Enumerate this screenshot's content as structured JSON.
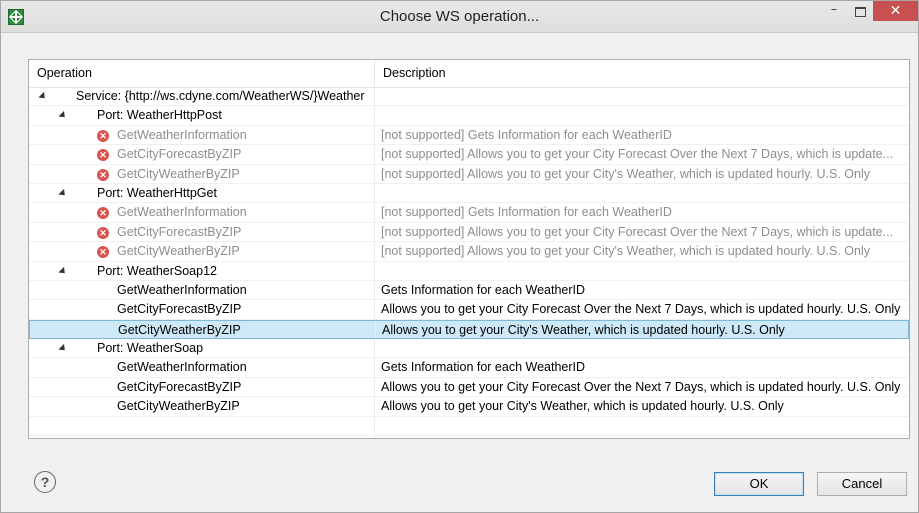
{
  "window": {
    "title": "Choose WS operation...",
    "controls": {
      "minimize": "–",
      "close": "✕"
    }
  },
  "table": {
    "columns": [
      "Operation",
      "Description"
    ],
    "rows": [
      {
        "level": 0,
        "op": "Service: {http://ws.cdyne.com/WeatherWS/}Weather",
        "desc": "",
        "error": false,
        "disabled": false
      },
      {
        "level": 1,
        "op": "Port: WeatherHttpPost",
        "desc": "",
        "error": false,
        "disabled": false
      },
      {
        "level": 2,
        "op": "GetWeatherInformation",
        "desc": "[not supported] Gets Information for each WeatherID",
        "error": true,
        "disabled": true
      },
      {
        "level": 2,
        "op": "GetCityForecastByZIP",
        "desc": "[not supported] Allows you to get your City Forecast Over the Next 7 Days, which is update...",
        "error": true,
        "disabled": true
      },
      {
        "level": 2,
        "op": "GetCityWeatherByZIP",
        "desc": "[not supported] Allows you to get your City's Weather, which is updated hourly. U.S. Only",
        "error": true,
        "disabled": true
      },
      {
        "level": 1,
        "op": "Port: WeatherHttpGet",
        "desc": "",
        "error": false,
        "disabled": false
      },
      {
        "level": 2,
        "op": "GetWeatherInformation",
        "desc": "[not supported] Gets Information for each WeatherID",
        "error": true,
        "disabled": true
      },
      {
        "level": 2,
        "op": "GetCityForecastByZIP",
        "desc": "[not supported] Allows you to get your City Forecast Over the Next 7 Days, which is update...",
        "error": true,
        "disabled": true
      },
      {
        "level": 2,
        "op": "GetCityWeatherByZIP",
        "desc": "[not supported] Allows you to get your City's Weather, which is updated hourly. U.S. Only",
        "error": true,
        "disabled": true
      },
      {
        "level": 1,
        "op": "Port: WeatherSoap12",
        "desc": "",
        "error": false,
        "disabled": false
      },
      {
        "level": 2,
        "op": "GetWeatherInformation",
        "desc": "Gets Information for each WeatherID",
        "error": false,
        "disabled": false
      },
      {
        "level": 2,
        "op": "GetCityForecastByZIP",
        "desc": "Allows you to get your City Forecast Over the Next 7 Days, which is updated hourly. U.S. Only",
        "error": false,
        "disabled": false
      },
      {
        "level": 2,
        "op": "GetCityWeatherByZIP",
        "desc": "Allows you to get your City's Weather, which is updated hourly. U.S. Only",
        "error": false,
        "disabled": false,
        "selected": true
      },
      {
        "level": 1,
        "op": "Port: WeatherSoap",
        "desc": "",
        "error": false,
        "disabled": false
      },
      {
        "level": 2,
        "op": "GetWeatherInformation",
        "desc": "Gets Information for each WeatherID",
        "error": false,
        "disabled": false
      },
      {
        "level": 2,
        "op": "GetCityForecastByZIP",
        "desc": "Allows you to get your City Forecast Over the Next 7 Days, which is updated hourly. U.S. Only",
        "error": false,
        "disabled": false
      },
      {
        "level": 2,
        "op": "GetCityWeatherByZIP",
        "desc": "Allows you to get your City's Weather, which is updated hourly. U.S. Only",
        "error": false,
        "disabled": false
      }
    ]
  },
  "footer": {
    "help": "?",
    "ok_label": "OK",
    "cancel_label": "Cancel"
  },
  "colors": {
    "selection": "#cde8f7",
    "error": "#d9534f",
    "close_button": "#c75050",
    "disabled_text": "#8e8e8e"
  }
}
